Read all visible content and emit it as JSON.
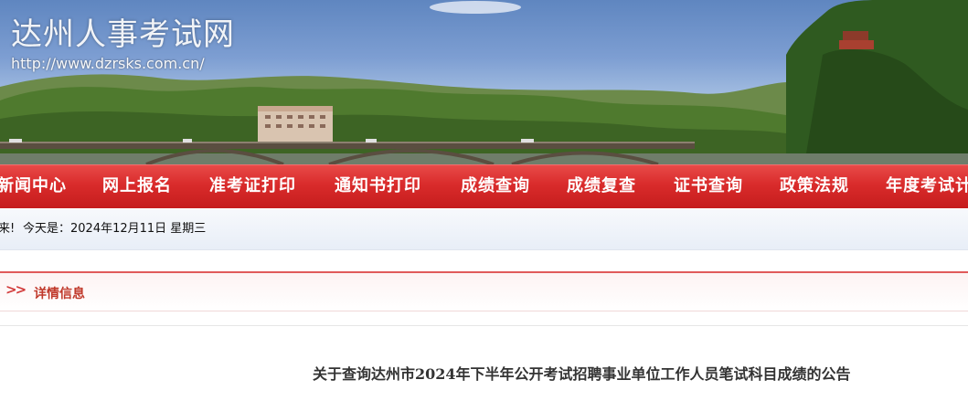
{
  "header": {
    "site_title": "达州人事考试网",
    "site_url": "http://www.dzrsks.com.cn/"
  },
  "nav": {
    "items": [
      {
        "label": "新闻中心"
      },
      {
        "label": "网上报名"
      },
      {
        "label": "准考证打印"
      },
      {
        "label": "通知书打印"
      },
      {
        "label": "成绩查询"
      },
      {
        "label": "成绩复查"
      },
      {
        "label": "证书查询"
      },
      {
        "label": "政策法规"
      },
      {
        "label": "年度考试计"
      }
    ]
  },
  "datebar": {
    "welcome": "来!",
    "today": "今天是：2024年12月11日 星期三"
  },
  "detail": {
    "label": "详情信息"
  },
  "article": {
    "title": "关于查询达州市2024年下半年公开考试招聘事业单位工作人员笔试科目成绩的公告"
  },
  "colors": {
    "nav_red": "#d92b2b",
    "accent_red": "#c0392b"
  }
}
